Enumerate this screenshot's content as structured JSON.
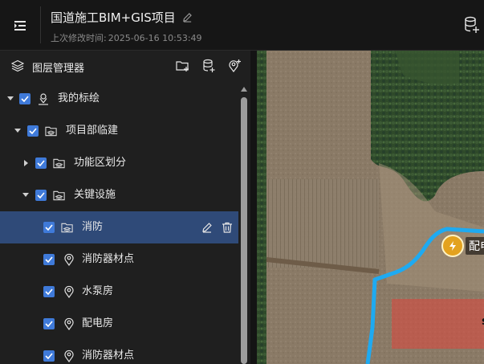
{
  "header": {
    "title": "国道施工BIM+GIS项目",
    "subtitle_label": "上次修改时间:",
    "subtitle_time": "2025-06-16 10:53:49"
  },
  "panel": {
    "title": "图层管理器"
  },
  "tree": [
    {
      "label": "我的标绘",
      "level": 0,
      "expanded": true,
      "checked": true,
      "icon": "user-pin-icon"
    },
    {
      "label": "项目部临建",
      "level": 1,
      "expanded": true,
      "checked": true,
      "icon": "folder-layers-icon"
    },
    {
      "label": "功能区划分",
      "level": 2,
      "expanded": false,
      "checked": true,
      "icon": "folder-layers-icon"
    },
    {
      "label": "关键设施",
      "level": 2,
      "expanded": true,
      "checked": true,
      "icon": "folder-layers-icon"
    },
    {
      "label": "消防",
      "level": 3,
      "checked": true,
      "icon": "folder-layers-icon",
      "selected": true
    },
    {
      "label": "消防器材点",
      "level": 3,
      "checked": true,
      "icon": "map-pin-icon"
    },
    {
      "label": "水泵房",
      "level": 3,
      "checked": true,
      "icon": "map-pin-icon"
    },
    {
      "label": "配电房",
      "level": 3,
      "checked": true,
      "icon": "map-pin-icon"
    },
    {
      "label": "消防器材点",
      "level": 3,
      "checked": true,
      "icon": "map-pin-icon"
    }
  ],
  "map": {
    "marker_label": "配电",
    "zone_text": "s"
  },
  "colors": {
    "accent": "#3f7ad9",
    "selected_row": "#2f4a78",
    "route": "#1eaaf1",
    "zone": "#e0463c"
  }
}
